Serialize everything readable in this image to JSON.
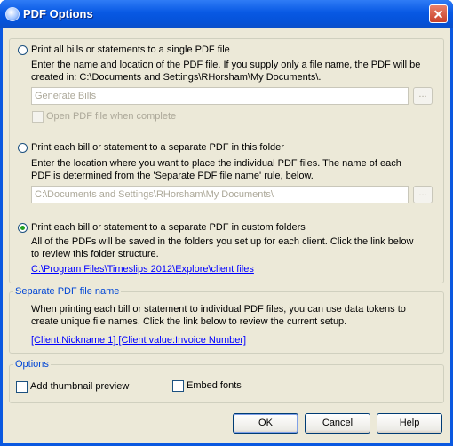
{
  "window": {
    "title": "PDF Options",
    "icon": "app-icon"
  },
  "options_top": {
    "radio1": {
      "label": "Print all bills or statements to a single PDF file",
      "selected": false
    },
    "desc1": "Enter the name and location of the PDF file. If you supply only a file name, the PDF will be created in: C:\\Documents and Settings\\RHorsham\\My Documents\\.",
    "field1": {
      "value": "Generate Bills"
    },
    "browse1": "...",
    "check_open": {
      "label": "Open PDF file when complete",
      "checked": false
    },
    "radio2": {
      "label": "Print each bill or statement to a separate PDF in this folder",
      "selected": false
    },
    "desc2": "Enter the location where you want to place the individual PDF files. The name of each PDF is determined from the 'Separate PDF file name' rule, below.",
    "field2": {
      "value": "C:\\Documents and Settings\\RHorsham\\My Documents\\"
    },
    "browse2": "...",
    "radio3": {
      "label": "Print each bill or statement to a separate PDF in custom folders",
      "selected": true
    },
    "desc3": "All of the PDFs will be saved in the folders you set up for each client. Click the link below to review this folder structure.",
    "link3": "C:\\Program Files\\Timeslips 2012\\Explore\\client files"
  },
  "separate_name": {
    "label": "Separate PDF file name",
    "desc": "When printing each bill or statement to individual PDF files, you can use data tokens to create unique file names. Click the link below to review the current setup.",
    "link": "[Client:Nickname 1] [Client value:Invoice Number]"
  },
  "options": {
    "label": "Options",
    "thumbnail": {
      "label": "Add thumbnail preview",
      "checked": false
    },
    "embed": {
      "label": "Embed fonts",
      "checked": false
    }
  },
  "buttons": {
    "ok": "OK",
    "cancel": "Cancel",
    "help": "Help"
  }
}
